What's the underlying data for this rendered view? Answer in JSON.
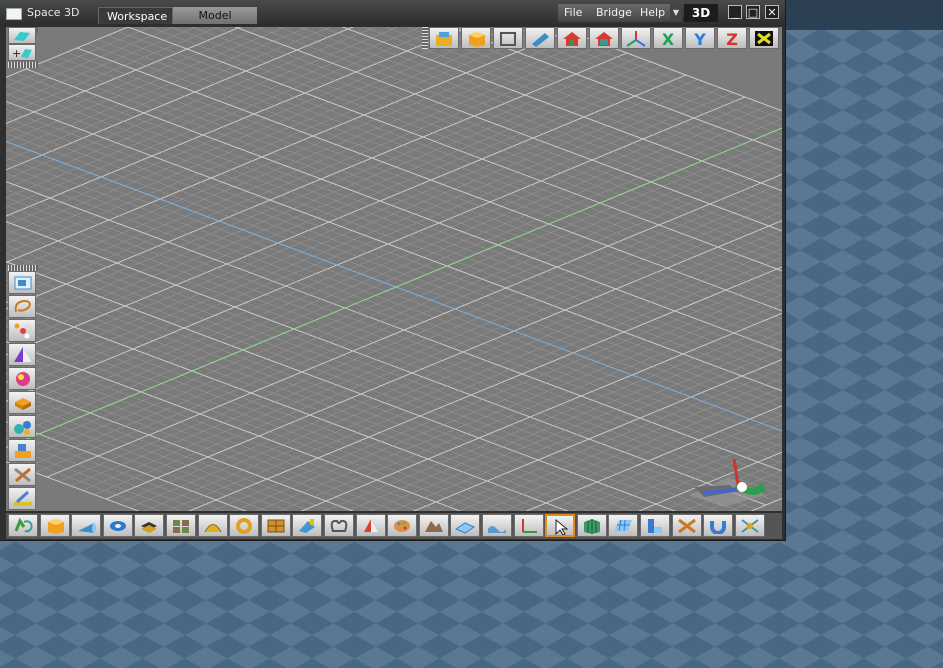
{
  "window": {
    "title": "Space 3D"
  },
  "tabs": [
    {
      "label": "Workspace",
      "active": true
    },
    {
      "label": "Model",
      "active": false
    }
  ],
  "menu": {
    "file": "File",
    "bridge": "Bridge",
    "help": "Help"
  },
  "view_mode": "3D",
  "window_controls": {
    "minimize": "_",
    "maximize": "□",
    "close": "✕"
  },
  "top_toolbar": [
    {
      "name": "open-folder-icon"
    },
    {
      "name": "solid-cube-icon"
    },
    {
      "name": "wireframe-box-icon"
    },
    {
      "name": "camera-icon"
    },
    {
      "name": "house-view-icon"
    },
    {
      "name": "house-view-alt-icon"
    },
    {
      "name": "axis-tripod-icon"
    },
    {
      "name": "x-axis-icon",
      "text": "X",
      "color": "#1aa35a"
    },
    {
      "name": "y-axis-icon",
      "text": "Y",
      "color": "#2a7de0"
    },
    {
      "name": "z-axis-icon",
      "text": "Z",
      "color": "#d8322a"
    },
    {
      "name": "fit-all-icon"
    }
  ],
  "left_toolbar": [
    "render-preview-icon",
    "lasso-select-icon",
    "atom-icon",
    "color-prism-icon",
    "color-sphere-icon",
    "open-box-icon",
    "bubbles-icon",
    "stack-blocks-icon",
    "tools-icon",
    "pencil-ruler-icon"
  ],
  "bottom_toolbar": [
    "recycle-icon",
    "cube-icon",
    "cone-icon",
    "torus-icon",
    "layers-icon",
    "tiles-icon",
    "sweep-icon",
    "ring-icon",
    "crate-icon",
    "paint-icon",
    "loop-curve-icon",
    "gradient-icon",
    "palette-icon",
    "terrain-icon",
    "plane-grid-icon",
    "wave-icon",
    "axes-icon",
    "pointer-icon",
    "grid-cube-icon",
    "grid-plane-icon",
    "extrude-icon",
    "cross-icon",
    "magnet-icon",
    "snap-icon"
  ],
  "colors": {
    "viewport": "#7a7a7a",
    "grid_line": "#d2d2d2",
    "x_axis_line": "#77b3e8",
    "y_axis_line": "#8fe08f",
    "desktop": "#4b6a86"
  }
}
